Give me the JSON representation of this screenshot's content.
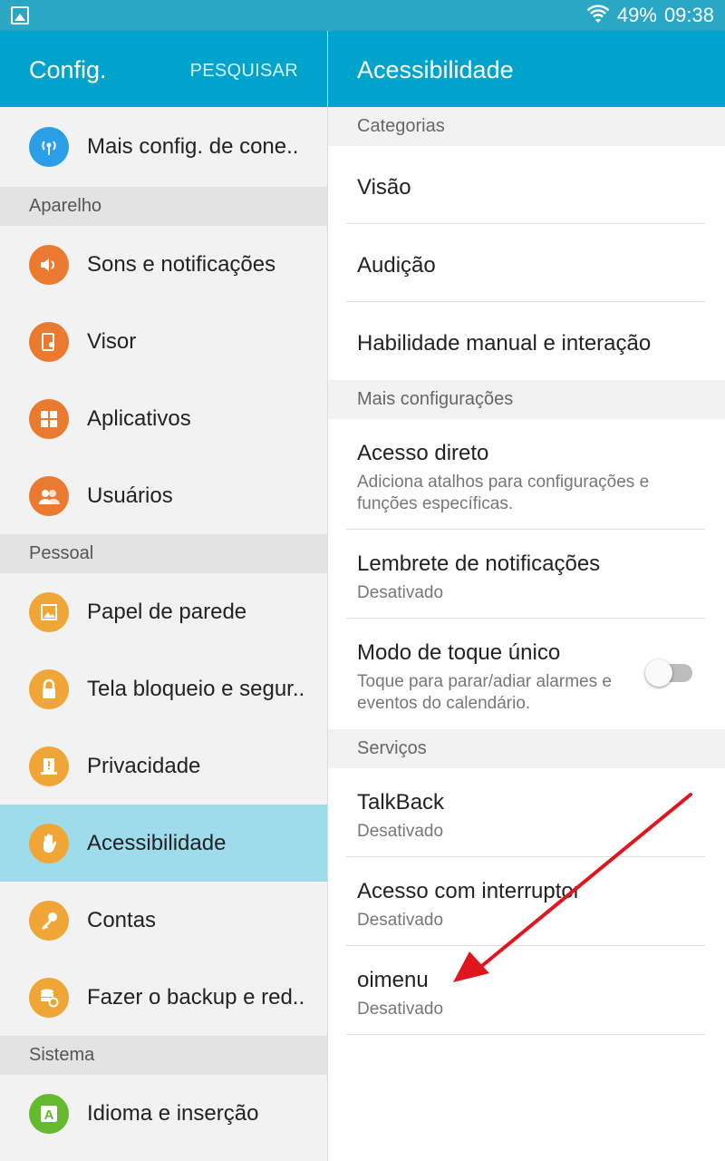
{
  "status_bar": {
    "battery": "49%",
    "time": "09:38",
    "icons": [
      "gallery-icon",
      "wifi-icon"
    ]
  },
  "left_panel": {
    "title": "Config.",
    "search_label": "PESQUISAR",
    "top_item": {
      "label": "Mais config. de cone..",
      "icon": "antenna-icon",
      "color": "#2b9ee8"
    },
    "sections": [
      {
        "header": "Aparelho",
        "items": [
          {
            "label": "Sons e notificações",
            "icon": "speaker-icon",
            "color": "#ea7a2f"
          },
          {
            "label": "Visor",
            "icon": "display-icon",
            "color": "#ea7a2f"
          },
          {
            "label": "Aplicativos",
            "icon": "apps-grid-icon",
            "color": "#ea7a2f"
          },
          {
            "label": "Usuários",
            "icon": "users-icon",
            "color": "#ea7a2f"
          }
        ]
      },
      {
        "header": "Pessoal",
        "items": [
          {
            "label": "Papel de parede",
            "icon": "wallpaper-icon",
            "color": "#f0a637"
          },
          {
            "label": "Tela bloqueio e segur..",
            "icon": "lock-icon",
            "color": "#f0a637"
          },
          {
            "label": "Privacidade",
            "icon": "privacy-icon",
            "color": "#f0a637"
          },
          {
            "label": "Acessibilidade",
            "icon": "hand-icon",
            "color": "#f0a637",
            "selected": true
          },
          {
            "label": "Contas",
            "icon": "key-icon",
            "color": "#f0a637"
          },
          {
            "label": "Fazer o backup e red..",
            "icon": "backup-icon",
            "color": "#f0a637"
          }
        ]
      },
      {
        "header": "Sistema",
        "items": [
          {
            "label": "Idioma e inserção",
            "icon": "language-icon",
            "color": "#64b92e"
          }
        ]
      }
    ]
  },
  "right_panel": {
    "title": "Acessibilidade",
    "categorias_header": "Categorias",
    "categorias": [
      "Visão",
      "Audição",
      "Habilidade manual e interação"
    ],
    "mais_header": "Mais configurações",
    "acesso_direto": {
      "title": "Acesso direto",
      "subtitle": "Adiciona atalhos para configurações e funções específicas."
    },
    "lembrete": {
      "title": "Lembrete de notificações",
      "subtitle": "Desativado"
    },
    "modo_toque": {
      "title": "Modo de toque único",
      "subtitle": "Toque para parar/adiar alarmes e eventos do calendário.",
      "enabled": false
    },
    "servicos_header": "Serviços",
    "talkback": {
      "title": "TalkBack",
      "subtitle": "Desativado"
    },
    "interruptor": {
      "title": "Acesso com interruptor",
      "subtitle": "Desativado"
    },
    "oimenu": {
      "title": "oimenu",
      "subtitle": "Desativado"
    }
  },
  "colors": {
    "appbar": "#00a3cc",
    "statusbar": "#2aa7c4",
    "selected": "#9edcec",
    "annotation_arrow": "#e0161f"
  }
}
